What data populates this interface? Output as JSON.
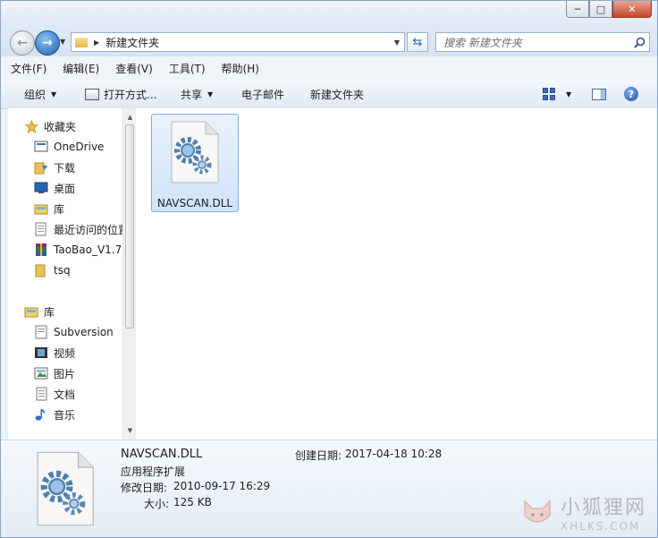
{
  "window": {
    "minimize_glyph": "─",
    "maximize_glyph": "□",
    "close_glyph": "✕"
  },
  "address": {
    "back_glyph": "←",
    "forward_glyph": "→",
    "path": "新建文件夹",
    "search_placeholder": "搜索 新建文件夹"
  },
  "menu": [
    "文件(F)",
    "编辑(E)",
    "查看(V)",
    "工具(T)",
    "帮助(H)"
  ],
  "toolbar": {
    "organize": "组织",
    "open_with": "打开方式...",
    "share": "共享",
    "email": "电子邮件",
    "new_folder": "新建文件夹",
    "help_glyph": "?"
  },
  "nav": {
    "favorites_label": "收藏夹",
    "favorites": [
      {
        "label": "OneDrive",
        "icon": "onedrive-icon"
      },
      {
        "label": "下载",
        "icon": "downloads-icon"
      },
      {
        "label": "桌面",
        "icon": "desktop-icon"
      },
      {
        "label": "库",
        "icon": "library-icon"
      },
      {
        "label": "最近访问的位置",
        "icon": "recent-places-icon"
      },
      {
        "label": "TaoBao_V1.7",
        "icon": "winrar-archive-icon"
      },
      {
        "label": "tsq",
        "icon": "folder-icon"
      }
    ],
    "libraries_label": "库",
    "libraries": [
      {
        "label": "Subversion",
        "icon": "subversion-icon"
      },
      {
        "label": "视频",
        "icon": "videos-icon"
      },
      {
        "label": "图片",
        "icon": "pictures-icon"
      },
      {
        "label": "文档",
        "icon": "documents-icon"
      },
      {
        "label": "音乐",
        "icon": "music-icon"
      }
    ]
  },
  "files": [
    {
      "name": "NAVSCAN.DLL",
      "icon": "dll-file-icon"
    }
  ],
  "details": {
    "name": "NAVSCAN.DLL",
    "type": "应用程序扩展",
    "modified_label": "修改日期:",
    "modified_value": "2010-09-17 16:29",
    "size_label": "大小:",
    "size_value": "125 KB",
    "created_label": "创建日期:",
    "created_value": "2017-04-18 10:28"
  },
  "watermark": {
    "line1": "小狐狸网",
    "line2": "XHLKS.COM"
  },
  "colors": {
    "accent": "#2a62b3",
    "selection": "#cfe3f9",
    "selection_border": "#84acdd"
  }
}
